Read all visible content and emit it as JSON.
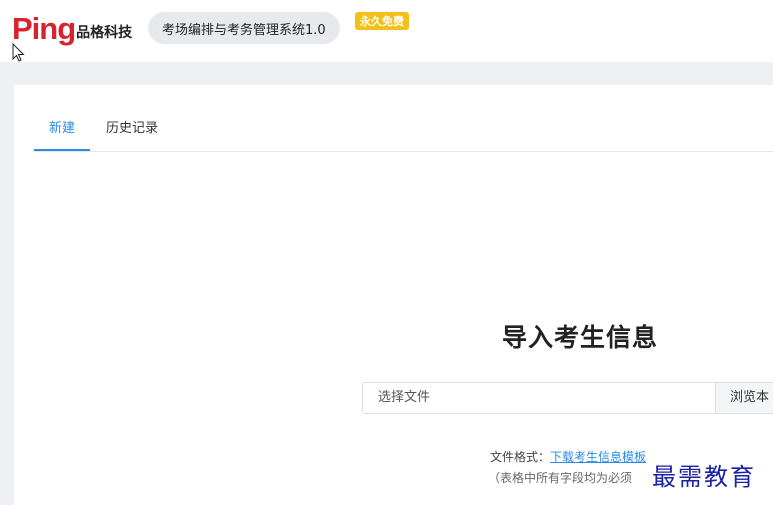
{
  "header": {
    "logo_mark": "Ping",
    "logo_text": "品格科技",
    "system_name": "考场编排与考务管理系统1.0",
    "badge": "永久免费"
  },
  "tabs": [
    {
      "label": "新建",
      "active": true
    },
    {
      "label": "历史记录",
      "active": false
    }
  ],
  "import": {
    "title": "导入考生信息",
    "file_placeholder": "选择文件",
    "browse_label": "浏览本",
    "format_label": "文件格式：",
    "format_link": "下载考生信息模板",
    "note": "（表格中所有字段均为必须"
  },
  "watermark": "最需教育",
  "colors": {
    "accent": "#2c8be4",
    "logo_red": "#d8222d",
    "badge_yellow": "#f3c01b",
    "watermark_blue": "#1a21a3"
  }
}
